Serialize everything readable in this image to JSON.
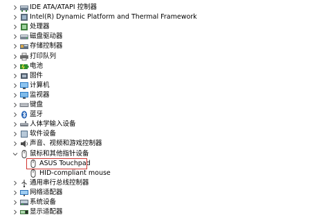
{
  "tree": {
    "items": [
      {
        "label": "IDE ATA/ATAPI 控制器",
        "state": "collapsed",
        "icon": "ide-controller-icon"
      },
      {
        "label": "Intel(R) Dynamic Platform and Thermal Framework",
        "state": "collapsed",
        "icon": "thermal-framework-icon"
      },
      {
        "label": "处理器",
        "state": "collapsed",
        "icon": "processor-icon"
      },
      {
        "label": "磁盘驱动器",
        "state": "collapsed",
        "icon": "disk-drive-icon"
      },
      {
        "label": "存储控制器",
        "state": "collapsed",
        "icon": "storage-controller-icon"
      },
      {
        "label": "打印队列",
        "state": "collapsed",
        "icon": "printer-icon"
      },
      {
        "label": "电池",
        "state": "collapsed",
        "icon": "battery-icon"
      },
      {
        "label": "固件",
        "state": "collapsed",
        "icon": "firmware-icon"
      },
      {
        "label": "计算机",
        "state": "collapsed",
        "icon": "computer-icon"
      },
      {
        "label": "监视器",
        "state": "collapsed",
        "icon": "monitor-icon"
      },
      {
        "label": "键盘",
        "state": "collapsed",
        "icon": "keyboard-icon"
      },
      {
        "label": "蓝牙",
        "state": "collapsed",
        "icon": "bluetooth-icon"
      },
      {
        "label": "人体学输入设备",
        "state": "collapsed",
        "icon": "hid-icon"
      },
      {
        "label": "软件设备",
        "state": "collapsed",
        "icon": "software-device-icon"
      },
      {
        "label": "声音、视频和游戏控制器",
        "state": "collapsed",
        "icon": "sound-icon"
      },
      {
        "label": "鼠标和其他指针设备",
        "state": "expanded",
        "icon": "mouse-icon"
      },
      {
        "label": "ASUS Touchpad",
        "state": "child",
        "icon": "mouse-icon",
        "highlighted": true
      },
      {
        "label": "HID-compliant mouse",
        "state": "child",
        "icon": "mouse-icon"
      },
      {
        "label": "通用串行总线控制器",
        "state": "collapsed",
        "icon": "usb-icon"
      },
      {
        "label": "网络适配器",
        "state": "collapsed",
        "icon": "network-adapter-icon"
      },
      {
        "label": "系统设备",
        "state": "collapsed",
        "icon": "system-device-icon"
      },
      {
        "label": "显示适配器",
        "state": "collapsed",
        "icon": "display-adapter-icon"
      }
    ]
  },
  "colors": {
    "highlight_border": "#d0312d",
    "chevron": "#555555",
    "text": "#000000"
  }
}
